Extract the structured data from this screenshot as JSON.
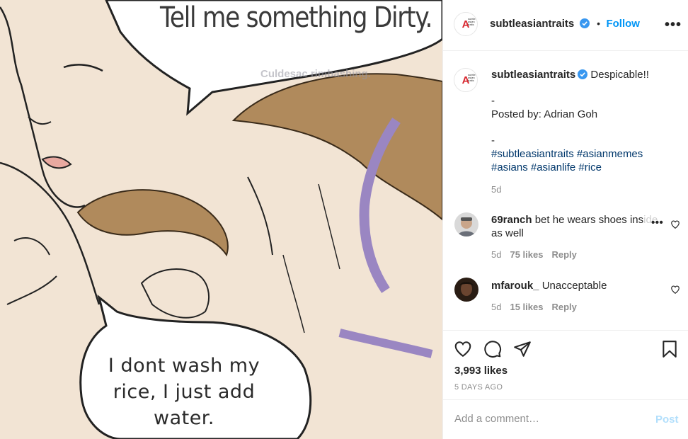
{
  "image": {
    "caption_top": "Tell me something Dirty.",
    "watermark": "Culdesac rimbashing.",
    "caption_bottom_line1": "I dont wash my",
    "caption_bottom_line2": "rice, I just add",
    "caption_bottom_line3": "water."
  },
  "header": {
    "username": "subtleasiantraits",
    "follow_separator": "•",
    "follow_label": "Follow",
    "more_label": "•••"
  },
  "logo": {
    "mark": "A",
    "mini_text": "subtle asian traits"
  },
  "caption": {
    "username": "subtleasiantraits",
    "text": "Despicable!!",
    "line_dash1": "-",
    "posted_by": "Posted by: Adrian Goh",
    "line_dash2": "-",
    "hashtags_line1": "#subtleasiantraits #asianmemes",
    "hashtags_line2": "#asians #asianlife #rice",
    "time": "5d"
  },
  "comments": [
    {
      "username": "69ranch",
      "text_line1": "bet he wears shoes ins",
      "faded": "ide",
      "text_line2": "as well",
      "time": "5d",
      "likes": "75 likes",
      "reply": "Reply",
      "more": "•••"
    },
    {
      "username": "mfarouk_",
      "text_line1": "Unacceptable",
      "time": "5d",
      "likes": "15 likes",
      "reply": "Reply"
    }
  ],
  "actions": {
    "likes": "3,993 likes",
    "time_ago": "5 DAYS AGO"
  },
  "comment_box": {
    "placeholder": "Add a comment…",
    "post_label": "Post"
  },
  "colors": {
    "accent": "#0095f6",
    "hashtag": "#00376b",
    "muted": "#8e8e8e",
    "post_disabled": "#b2dffc",
    "verified": "#3897f0"
  }
}
